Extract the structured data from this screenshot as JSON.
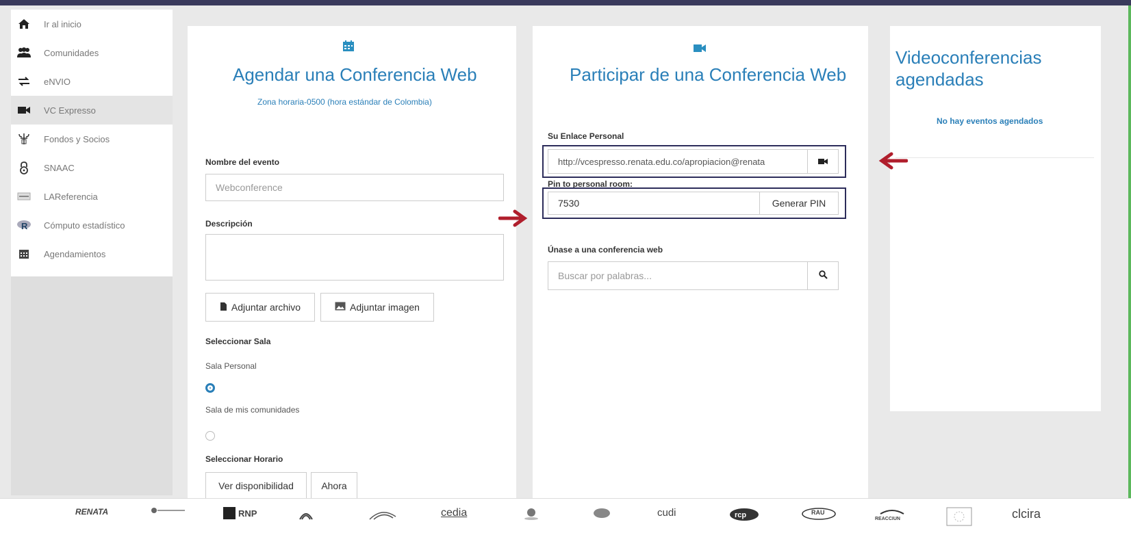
{
  "sidebar": {
    "items": [
      {
        "label": "Ir al inicio",
        "icon": "home-icon"
      },
      {
        "label": "Comunidades",
        "icon": "users-icon"
      },
      {
        "label": "eNVIO",
        "icon": "exchange-icon"
      },
      {
        "label": "VC Expresso",
        "icon": "video-camera-icon"
      },
      {
        "label": "Fondos y Socios",
        "icon": "funds-icon"
      },
      {
        "label": "SNAAC",
        "icon": "lock-icon"
      },
      {
        "label": "LAReferencia",
        "icon": "reference-icon"
      },
      {
        "label": "Cómputo estadístico",
        "icon": "r-logo-icon"
      },
      {
        "label": "Agendamientos",
        "icon": "calendar-icon"
      }
    ]
  },
  "schedule": {
    "title": "Agendar una Conferencia Web",
    "timezone": "Zona horaria-0500 (hora estándar de Colombia)",
    "event_name_label": "Nombre del evento",
    "event_name_placeholder": "Webconference",
    "description_label": "Descripción",
    "attach_file": "Adjuntar archivo",
    "attach_image": "Adjuntar imagen",
    "select_room_label": "Seleccionar Sala",
    "room_personal": "Sala Personal",
    "room_communities": "Sala de mis comunidades",
    "select_time_label": "Seleccionar Horario",
    "see_availability": "Ver disponibilidad",
    "now": "Ahora"
  },
  "join": {
    "title": "Participar de una Conferencia Web",
    "personal_link_label": "Su Enlace Personal",
    "personal_link_value": "http://vcespresso.renata.edu.co/apropiacion@renata",
    "pin_label": "Pin to personal room:",
    "pin_value": "7530",
    "generate_pin": "Generar PIN",
    "join_label": "Únase a una conferencia web",
    "search_placeholder": "Buscar por palabras..."
  },
  "scheduled": {
    "title": "Videoconferencias agendadas",
    "empty": "No hay eventos agendados"
  },
  "footer": {
    "logos": [
      "RENATA",
      "RNP",
      "cedia",
      "cudi",
      "RAU",
      "REACCIUN",
      "clcira"
    ]
  },
  "colors": {
    "accent": "#2a7fb8",
    "highlight_border": "#2c2c5a",
    "arrow": "#b01e2c"
  }
}
